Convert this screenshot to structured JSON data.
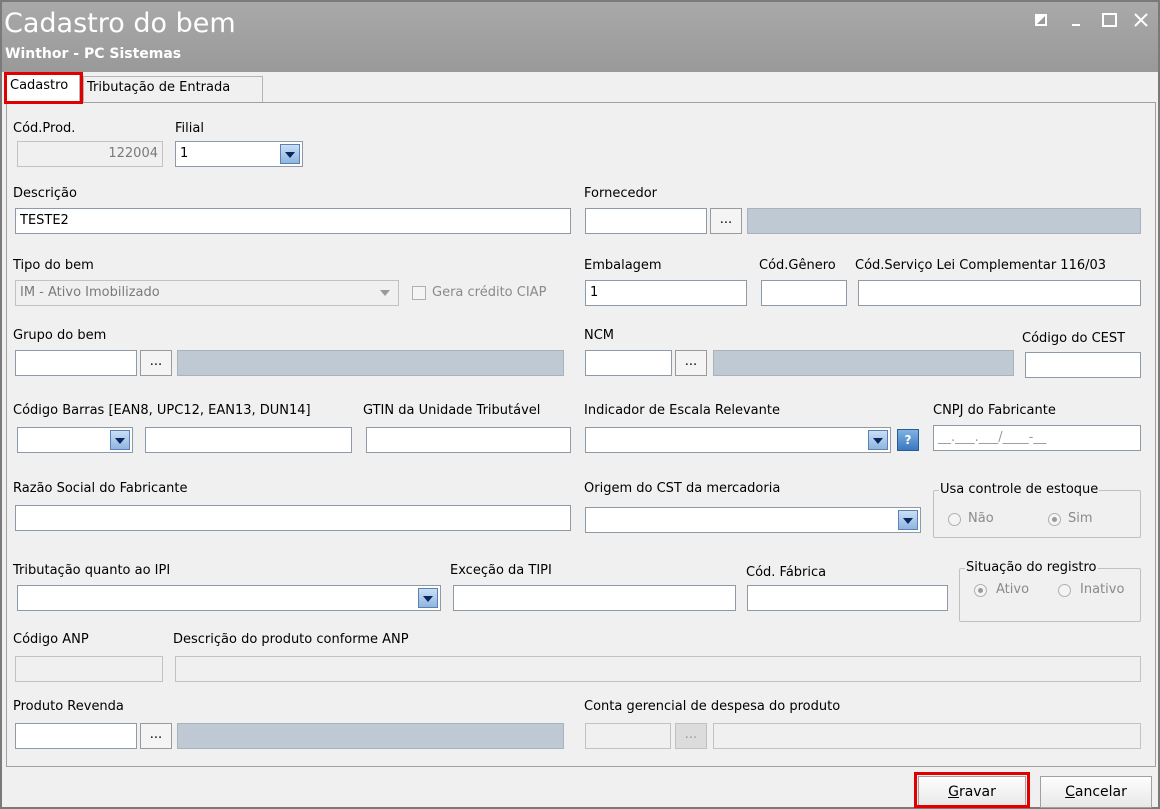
{
  "window": {
    "title": "Cadastro do bem",
    "subtitle": "Winthor - PC Sistemas",
    "buttons": [
      "restore",
      "minimize",
      "maximize",
      "close"
    ]
  },
  "tabs": [
    {
      "label": "Cadastro",
      "active": true
    },
    {
      "label": "Tributação de Entrada",
      "active": false
    }
  ],
  "form": {
    "cod_prod": {
      "label": "Cód.Prod.",
      "value": "122004"
    },
    "filial": {
      "label": "Filial",
      "value": "1"
    },
    "descricao": {
      "label": "Descrição",
      "value": "TESTE2"
    },
    "fornecedor": {
      "label": "Fornecedor",
      "value": "",
      "button": "..."
    },
    "tipo_bem": {
      "label": "Tipo do bem",
      "value": "IM - Ativo Imobilizado"
    },
    "gera_credito": {
      "label": "Gera crédito CIAP",
      "checked": false
    },
    "embalagem": {
      "label": "Embalagem",
      "value": "1"
    },
    "cod_genero": {
      "label": "Cód.Gênero",
      "value": ""
    },
    "cod_servico": {
      "label": "Cód.Serviço Lei Complementar 116/03",
      "value": ""
    },
    "grupo_bem": {
      "label": "Grupo do bem",
      "value": "",
      "button": "..."
    },
    "ncm": {
      "label": "NCM",
      "value": "",
      "button": "..."
    },
    "cest": {
      "label": "Código do CEST",
      "value": ""
    },
    "codigo_barras": {
      "label": "Código Barras [EAN8, UPC12, EAN13, DUN14]",
      "value": ""
    },
    "gtin": {
      "label": "GTIN da Unidade Tributável",
      "value": ""
    },
    "escala_relevante": {
      "label": "Indicador de Escala Relevante",
      "value": "",
      "help": "?"
    },
    "cnpj_fabricante": {
      "label": "CNPJ do Fabricante",
      "placeholder": "__.___.___/____-__"
    },
    "razao_social": {
      "label": "Razão Social do Fabricante",
      "value": ""
    },
    "origem_cst": {
      "label": "Origem do CST da mercadoria",
      "value": ""
    },
    "controle_estoque": {
      "label": "Usa controle de estoque",
      "options": [
        "Não",
        "Sim"
      ],
      "selected": "Sim"
    },
    "trib_ipi": {
      "label": "Tributação quanto ao IPI",
      "value": ""
    },
    "excecao_tipi": {
      "label": "Exceção da TIPI",
      "value": ""
    },
    "cod_fabrica": {
      "label": "Cód. Fábrica",
      "value": ""
    },
    "situacao": {
      "label": "Situação do registro",
      "options": [
        "Ativo",
        "Inativo"
      ],
      "selected": "Ativo"
    },
    "codigo_anp": {
      "label": "Código ANP",
      "value": ""
    },
    "descricao_anp": {
      "label": "Descrição do produto conforme ANP",
      "value": ""
    },
    "produto_revenda": {
      "label": "Produto Revenda",
      "value": "",
      "button": "..."
    },
    "conta_gerencial": {
      "label": "Conta gerencial de despesa do produto",
      "value": "",
      "button": "..."
    }
  },
  "footer": {
    "gravar": {
      "hotkey": "G",
      "rest": "ravar"
    },
    "cancelar": {
      "hotkey": "C",
      "rest": "ancelar"
    }
  },
  "highlight_color": "#e00000"
}
